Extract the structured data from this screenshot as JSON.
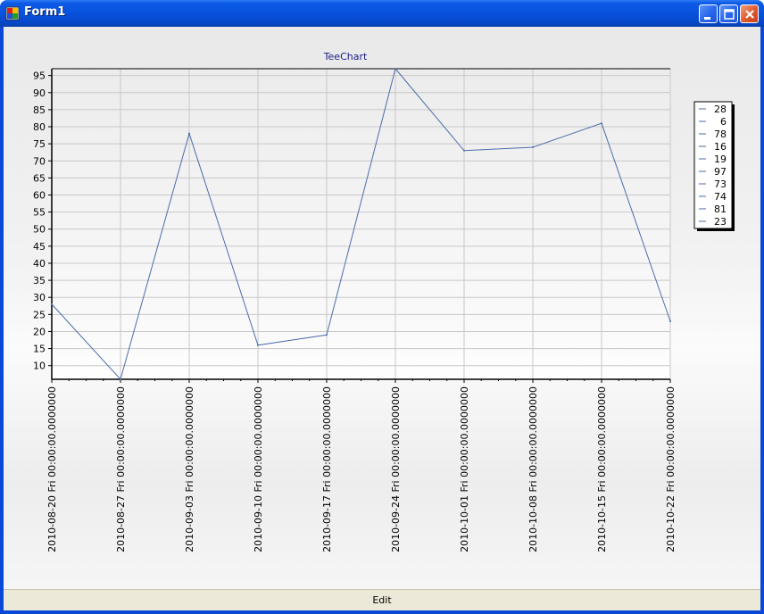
{
  "window": {
    "title": "Form1"
  },
  "edit_button": {
    "label": "Edit"
  },
  "colors": {
    "title_text": "#1a1a8c",
    "series_line": "#4a6ea9",
    "grid": "#c8c8c8",
    "axis": "#000000"
  },
  "chart_data": {
    "type": "line",
    "title": "TeeChart",
    "x": [
      "2010-08-20 Fri 00:00:00.0000000",
      "2010-08-27 Fri 00:00:00.0000000",
      "2010-09-03 Fri 00:00:00.0000000",
      "2010-09-10 Fri 00:00:00.0000000",
      "2010-09-17 Fri 00:00:00.0000000",
      "2010-09-24 Fri 00:00:00.0000000",
      "2010-10-01 Fri 00:00:00.0000000",
      "2010-10-08 Fri 00:00:00.0000000",
      "2010-10-15 Fri 00:00:00.0000000",
      "2010-10-22 Fri 00:00:00.0000000"
    ],
    "series": [
      {
        "values": [
          28,
          6,
          78,
          16,
          19,
          97,
          73,
          74,
          81,
          23
        ]
      }
    ],
    "ylim": [
      6,
      97
    ],
    "yticks": [
      10,
      15,
      20,
      25,
      30,
      35,
      40,
      45,
      50,
      55,
      60,
      65,
      70,
      75,
      80,
      85,
      90,
      95
    ],
    "legend": {
      "placement": "right",
      "entries": [
        "28",
        "6",
        "78",
        "16",
        "19",
        "97",
        "73",
        "74",
        "81",
        "23"
      ]
    },
    "grid": true
  }
}
